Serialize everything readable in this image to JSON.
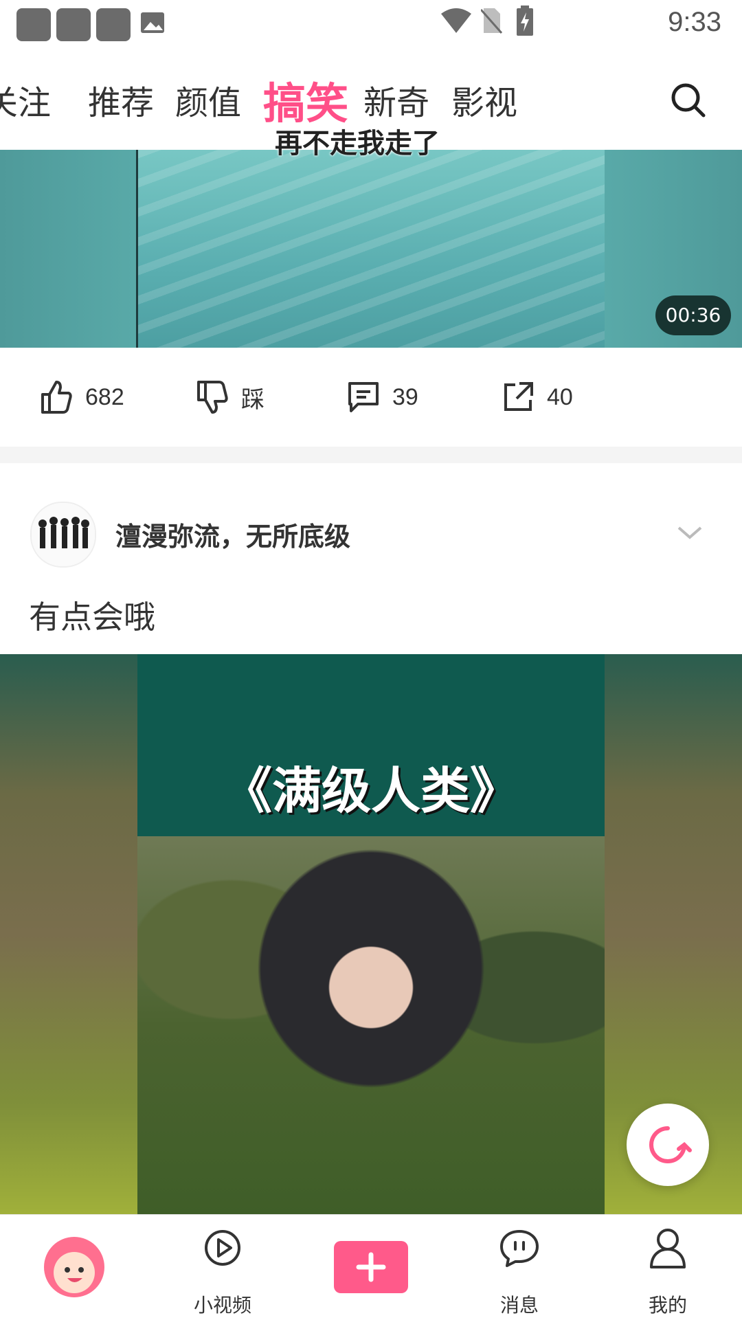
{
  "status_bar": {
    "time": "9:33",
    "icons": [
      "app-icon",
      "app-icon",
      "app-icon",
      "image-icon",
      "wifi-icon",
      "no-sim-icon",
      "battery-charging-icon"
    ]
  },
  "top_nav": {
    "tabs": [
      {
        "label": "关注",
        "active": false
      },
      {
        "label": "推荐",
        "active": false
      },
      {
        "label": "颜值",
        "active": false
      },
      {
        "label": "搞笑",
        "active": true
      },
      {
        "label": "新奇",
        "active": false
      },
      {
        "label": "影视",
        "active": false
      }
    ],
    "search_icon": "search-icon",
    "accent_color": "#ff4f88"
  },
  "post1": {
    "video_caption": "再不走我走了",
    "duration": "00:36",
    "actions": {
      "like_count": "682",
      "dislike_label": "踩",
      "comment_count": "39",
      "share_count": "40"
    }
  },
  "post2": {
    "author": "澶漫弥流，无所底级",
    "text": "有点会哦",
    "video_title": "《满级人类》"
  },
  "bottom_nav": {
    "items": [
      {
        "label": "",
        "icon": "avatar-icon"
      },
      {
        "label": "小视频",
        "icon": "play-icon"
      },
      {
        "label": "",
        "icon": "plus-icon"
      },
      {
        "label": "消息",
        "icon": "message-icon"
      },
      {
        "label": "我的",
        "icon": "user-icon"
      }
    ]
  }
}
